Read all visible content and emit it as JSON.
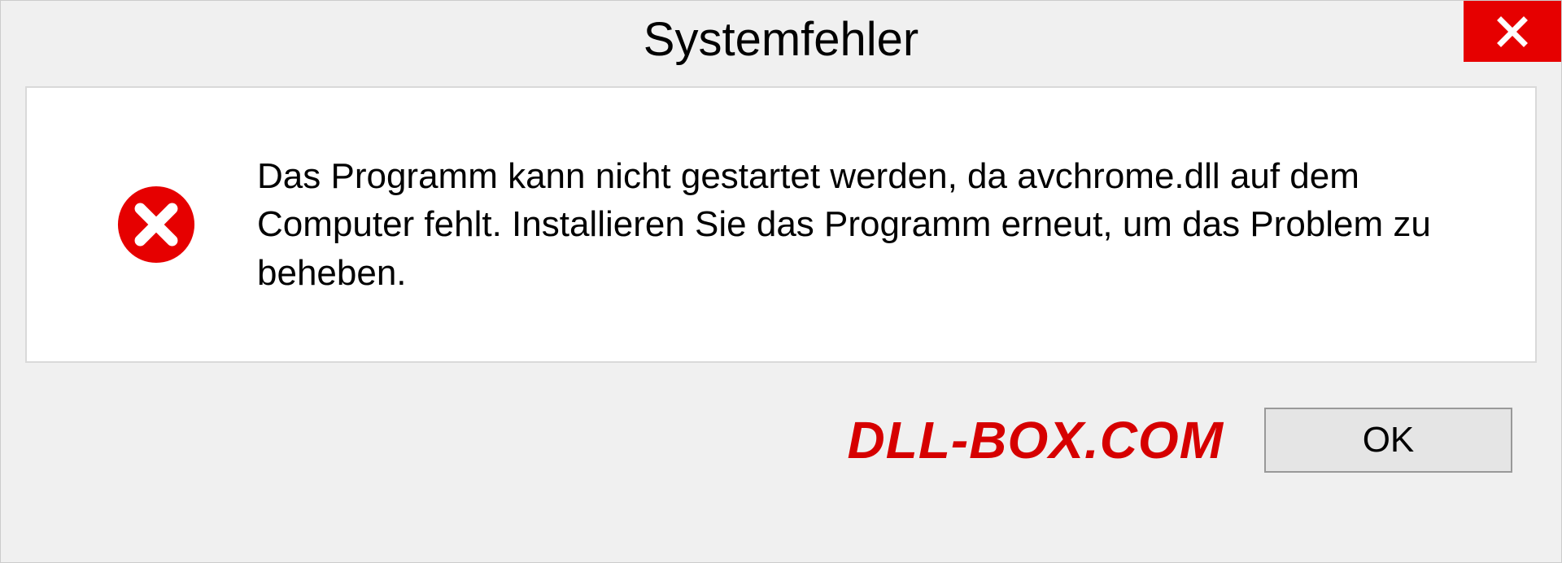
{
  "dialog": {
    "title": "Systemfehler",
    "message": "Das Programm kann nicht gestartet werden, da avchrome.dll auf dem Computer fehlt. Installieren Sie das Programm erneut, um das Problem zu beheben.",
    "ok_label": "OK"
  },
  "watermark": "DLL-BOX.COM",
  "colors": {
    "error_red": "#e60000",
    "watermark_red": "#d60000"
  }
}
